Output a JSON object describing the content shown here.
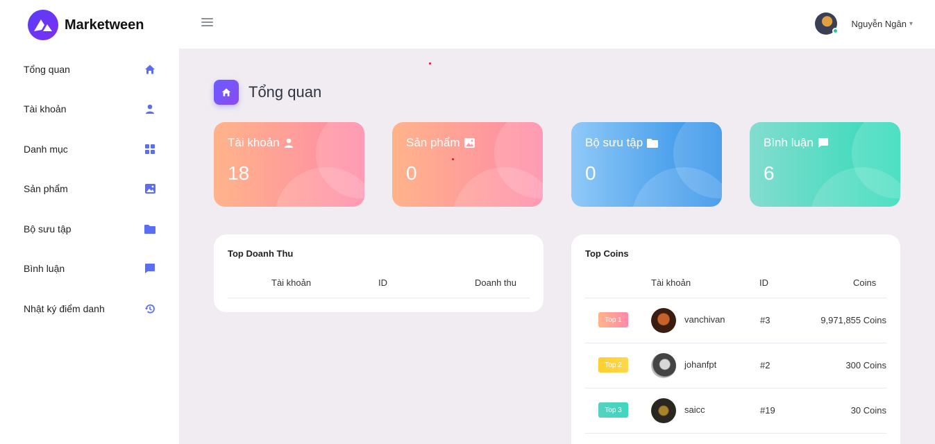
{
  "app": {
    "brand": "Marketween"
  },
  "header": {
    "user_name": "Nguyễn Ngân",
    "caret": "▾"
  },
  "sidebar": {
    "items": [
      {
        "label": "Tổng quan",
        "icon": "home-icon"
      },
      {
        "label": "Tài khoản",
        "icon": "user-icon"
      },
      {
        "label": "Danh mục",
        "icon": "grid-icon"
      },
      {
        "label": "Sản phẩm",
        "icon": "image-icon"
      },
      {
        "label": "Bộ sưu tập",
        "icon": "folder-icon"
      },
      {
        "label": "Bình luận",
        "icon": "comment-icon"
      },
      {
        "label": "Nhật ký điểm danh",
        "icon": "history-icon"
      }
    ]
  },
  "page": {
    "title": "Tổng quan"
  },
  "stats": [
    {
      "label": "Tài khoản",
      "value": "18",
      "icon": "user-icon",
      "color": "#ff9a9e"
    },
    {
      "label": "Sản phẩm",
      "value": "0",
      "icon": "image-icon",
      "color": "#ff8fa3"
    },
    {
      "label": "Bộ sưu tập",
      "value": "0",
      "icon": "folder-icon",
      "color": "#3a9bf0"
    },
    {
      "label": "Bình luận",
      "value": "6",
      "icon": "comment-icon",
      "color": "#3dd6bf"
    }
  ],
  "revenue": {
    "title": "Top Doanh Thu",
    "columns": [
      "Tài khoản",
      "ID",
      "Doanh thu"
    ]
  },
  "coins": {
    "title": "Top Coins",
    "columns": [
      "Tài khoản",
      "ID",
      "Coins"
    ],
    "rows": [
      {
        "badge": "Top 1",
        "name": "vanchivan",
        "id": "#3",
        "coins": "9,971,855 Coins",
        "badge_color": "#ff8a95"
      },
      {
        "badge": "Top 2",
        "name": "johanfpt",
        "id": "#2",
        "coins": "300 Coins",
        "badge_color": "#fccf31"
      },
      {
        "badge": "Top 3",
        "name": "saicc",
        "id": "#19",
        "coins": "30 Coins",
        "badge_color": "#3dd6bf"
      }
    ]
  }
}
